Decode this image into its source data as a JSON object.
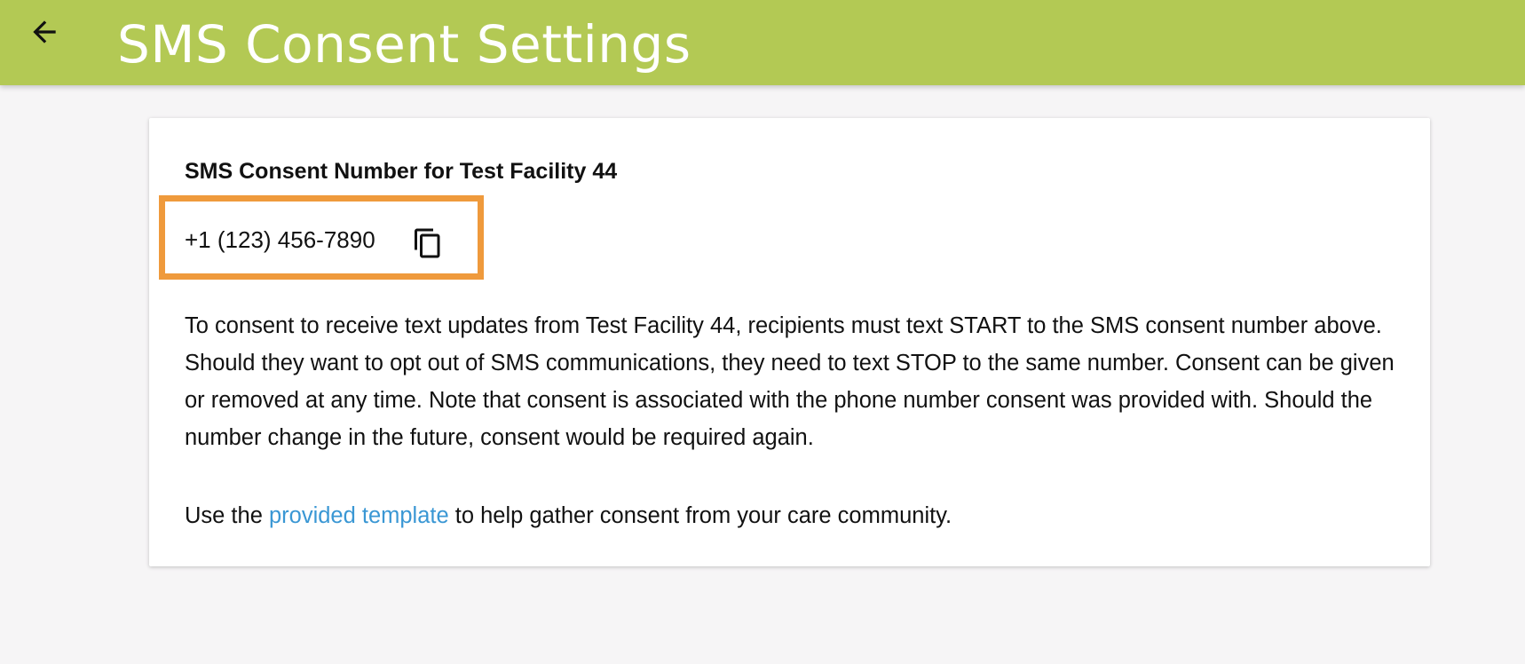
{
  "header": {
    "title": "SMS Consent Settings",
    "back_icon": "arrow-left-icon",
    "background_color": "#b3c954",
    "title_color": "#ffffff"
  },
  "card": {
    "heading": "SMS Consent Number for Test Facility 44",
    "phone_number": "+1 (123) 456-7890",
    "copy_icon": "copy-icon",
    "highlight_color": "#ef9a3c",
    "description": "To consent to receive text updates from Test Facility 44, recipients must text START to the SMS consent number above. Should they want to opt out of SMS communications, they need to text STOP to the same number. Consent can be given or removed at any time. Note that consent is associated with the phone number consent was provided with. Should the number change in the future, consent would be required again.",
    "template_prefix": "Use the ",
    "template_link": "provided template",
    "template_suffix": " to help gather consent from your care community.",
    "link_color": "#3a97d4"
  }
}
